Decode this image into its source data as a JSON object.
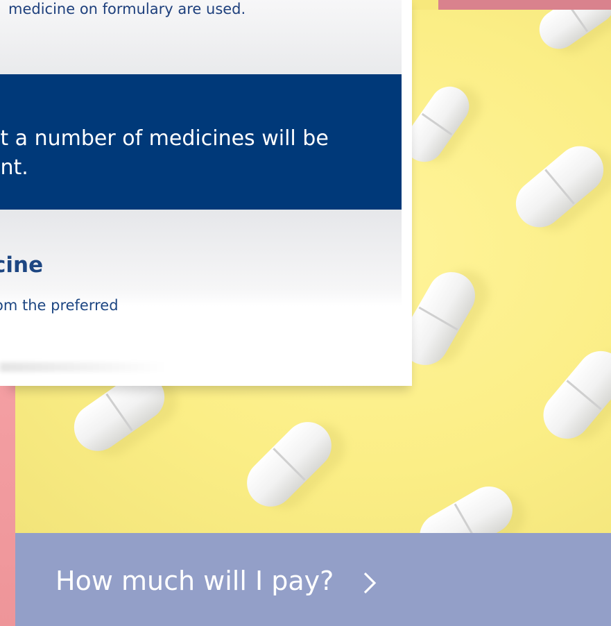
{
  "card": {
    "section1_text": "medicine on formulary are used.",
    "section2_text_line1": "at a number of medicines will be",
    "section2_text_line2": "ent.",
    "section3_heading": "cine",
    "section3_text": "om the preferred"
  },
  "cta": {
    "label": "How much will I pay?",
    "icon": "chevron-right-icon"
  },
  "colors": {
    "navy": "#003979",
    "text_blue": "#1d4682",
    "cta_bg": "#939fc8",
    "pink": "#f4a0a2",
    "yellow": "#fbee86"
  }
}
